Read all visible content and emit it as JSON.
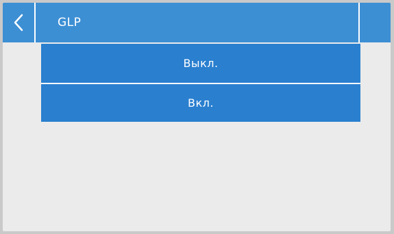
{
  "header": {
    "title": "GLP",
    "back_icon": "chevron-left-icon"
  },
  "options": [
    {
      "label": "Выкл."
    },
    {
      "label": "Вкл."
    }
  ],
  "colors": {
    "header": "#3d8fd4",
    "option": "#2a7fcf",
    "background": "#ebebeb",
    "text": "#ffffff"
  }
}
